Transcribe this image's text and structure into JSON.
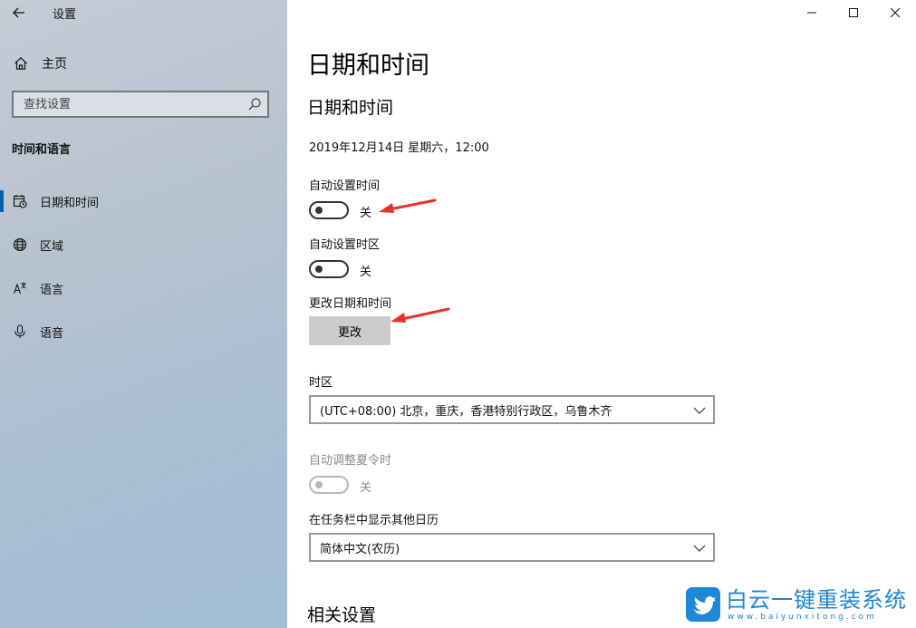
{
  "window": {
    "app_title": "设置",
    "controls": {
      "minimize": "minimize",
      "maximize": "maximize",
      "close": "close"
    }
  },
  "sidebar": {
    "home_label": "主页",
    "search": {
      "placeholder": "查找设置"
    },
    "section_title": "时间和语言",
    "items": [
      {
        "label": "日期和时间",
        "icon": "calendar-clock-icon",
        "active": true
      },
      {
        "label": "区域",
        "icon": "globe-icon",
        "active": false
      },
      {
        "label": "语言",
        "icon": "language-icon",
        "active": false
      },
      {
        "label": "语音",
        "icon": "microphone-icon",
        "active": false
      }
    ]
  },
  "main": {
    "page_title": "日期和时间",
    "section_title": "日期和时间",
    "current_datetime": "2019年12月14日 星期六，12:00",
    "auto_time": {
      "label": "自动设置时间",
      "state": "关"
    },
    "auto_timezone": {
      "label": "自动设置时区",
      "state": "关"
    },
    "change_datetime": {
      "label": "更改日期和时间",
      "button": "更改"
    },
    "timezone": {
      "label": "时区",
      "value": "(UTC+08:00) 北京，重庆，香港特别行政区，乌鲁木齐"
    },
    "dst": {
      "label": "自动调整夏令时",
      "state": "关"
    },
    "calendar": {
      "label": "在任务栏中显示其他日历",
      "value": "简体中文(农历)"
    },
    "related_title": "相关设置"
  },
  "watermark": {
    "title": "白云一键重装系统",
    "url": "www.baiyunxitong.com"
  },
  "colors": {
    "accent": "#0063b1",
    "annotation_arrow": "#e8322e",
    "watermark": "#1d87d8"
  }
}
